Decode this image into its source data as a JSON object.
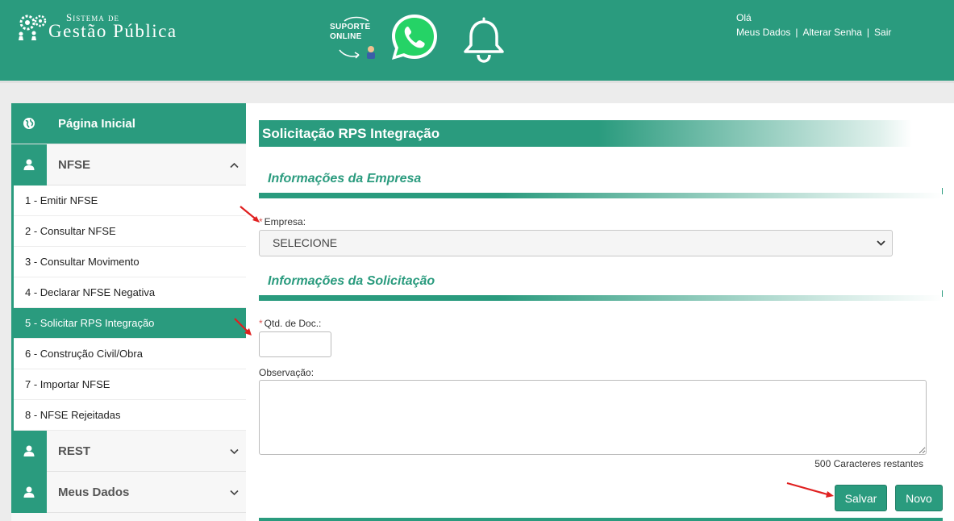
{
  "header": {
    "logo_line1": "Sistema de",
    "logo_line2": "Gestão Pública",
    "support_line1": "SUPORTE",
    "support_line2": "ONLINE",
    "greeting": "Olá",
    "links": [
      {
        "label": "Meus Dados"
      },
      {
        "label": "Alterar Senha"
      },
      {
        "label": "Sair"
      }
    ],
    "separator": "|"
  },
  "sidebar": {
    "home": {
      "label": "Página Inicial",
      "icon": "globe-icon"
    },
    "nfse": {
      "label": "NFSE",
      "icon": "user-icon",
      "items": [
        {
          "label": "1 - Emitir NFSE"
        },
        {
          "label": "2 - Consultar NFSE"
        },
        {
          "label": "3 - Consultar Movimento"
        },
        {
          "label": "4 - Declarar NFSE Negativa"
        },
        {
          "label": "5 - Solicitar RPS Integração"
        },
        {
          "label": "6 - Construção Civil/Obra"
        },
        {
          "label": "7 - Importar NFSE"
        },
        {
          "label": "8 - NFSE Rejeitadas"
        }
      ],
      "active_index": 4
    },
    "rest": {
      "label": "REST",
      "icon": "user-icon"
    },
    "meus_dados": {
      "label": "Meus Dados",
      "icon": "user-icon"
    }
  },
  "main": {
    "title": "Solicitação RPS Integração",
    "section_empresa": "Informações da Empresa",
    "empresa_label": "Empresa:",
    "required_mark": "*",
    "empresa_value": "SELECIONE",
    "section_solicitacao": "Informações da Solicitação",
    "qtd_label": "Qtd. de Doc.:",
    "qtd_value": "",
    "obs_label": "Observação:",
    "obs_value": "",
    "char_count": "500 Caracteres restantes",
    "save_label": "Salvar",
    "new_label": "Novo"
  },
  "colors": {
    "primary": "#2a9b7e",
    "annotation_arrow": "#e02020"
  }
}
